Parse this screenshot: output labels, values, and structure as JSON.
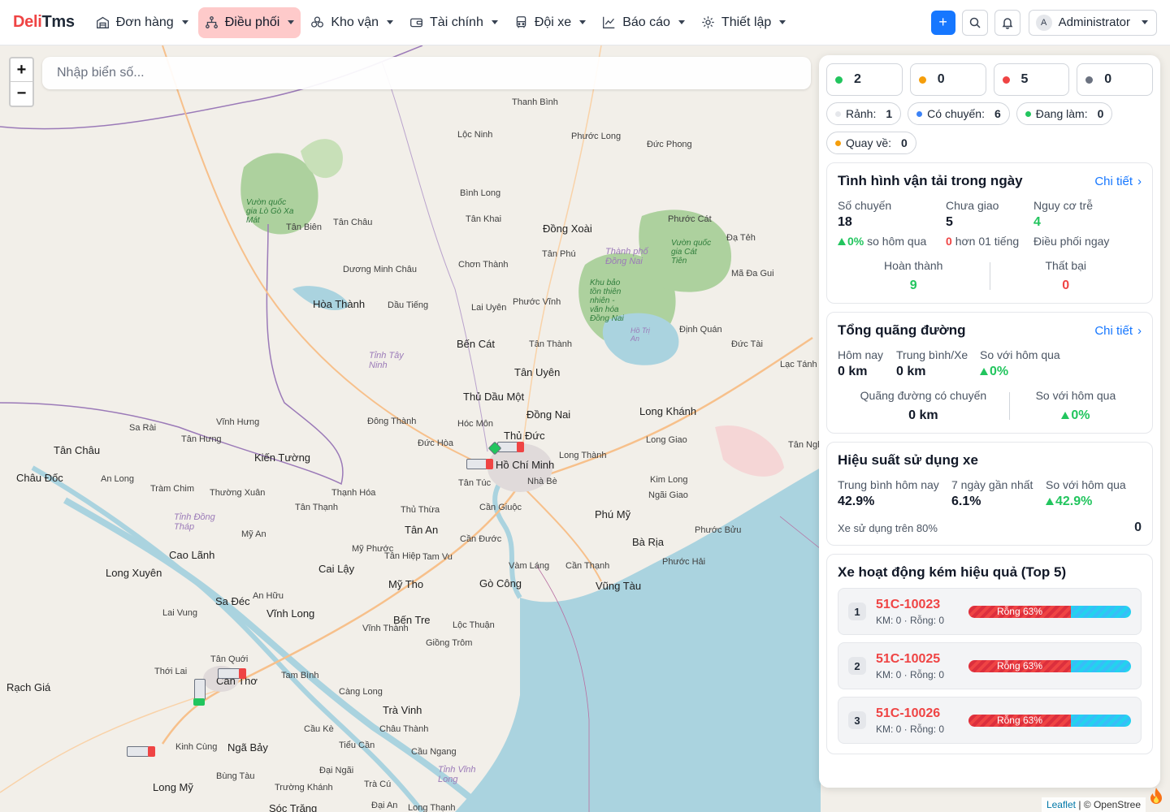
{
  "brand": {
    "part1": "Deli",
    "part2": "Tms"
  },
  "nav": [
    {
      "label": "Đơn hàng",
      "icon": "warehouse-icon"
    },
    {
      "label": "Điều phối",
      "icon": "route-icon",
      "active": true
    },
    {
      "label": "Kho vận",
      "icon": "boxes-icon"
    },
    {
      "label": "Tài chính",
      "icon": "wallet-icon"
    },
    {
      "label": "Đội xe",
      "icon": "bus-icon"
    },
    {
      "label": "Báo cáo",
      "icon": "chart-line-icon"
    },
    {
      "label": "Thiết lập",
      "icon": "gear-icon"
    }
  ],
  "header_actions": {
    "add": "+",
    "user": "Administrator",
    "avatar_initial": "A"
  },
  "map": {
    "search_placeholder": "Nhập biển số...",
    "zoom_in": "+",
    "zoom_out": "−",
    "attribution_leaflet": "Leaflet",
    "attribution_rest": "| © OpenStree",
    "labels": [
      "Thanh Bình",
      "Lộc Ninh",
      "Phước Long",
      "Đức Phong",
      "Bình Long",
      "Tân Khai",
      "Đồng Xoài",
      "Phước Cát",
      "Tân Biên",
      "Tân Châu",
      "Dương Minh Châu",
      "Chơn Thành",
      "Tân Phú",
      "Hòa Thành",
      "Dầu Tiếng",
      "Lai Uyên",
      "Phước Vĩnh",
      "Bến Cát",
      "Tân Thành",
      "Tân Uyên",
      "Thủ Dầu Một",
      "Đồng Nai",
      "Long Khánh",
      "Thủ Đức",
      "Hóc Môn",
      "Hồ Chí Minh",
      "Tân Túc",
      "Nhà Bè",
      "Long Thành",
      "Long Giao",
      "Kim Long",
      "Ngãi Giao",
      "Phú Mỹ",
      "Bà Rịa",
      "Phước Bửu",
      "Phước Hải",
      "Vũng Tàu",
      "Cần Thạnh",
      "Vàm Láng",
      "Gò Công",
      "Cần Giuộc",
      "Cần Đước",
      "Tân An",
      "Thủ Thừa",
      "Tân Thạnh",
      "Thạnh Hóa",
      "Đức Hòa",
      "Đông Thành",
      "Kiến Tường",
      "Vĩnh Hưng",
      "Tân Hưng",
      "Sa Rài",
      "Tân Châu",
      "Châu Đốc",
      "An Long",
      "Tràm Chim",
      "Thường Xuân",
      "Cao Lãnh",
      "Mỹ An",
      "Mỹ Phước",
      "Tân Hiệp",
      "Tam Vu",
      "Mỹ Tho",
      "Cai Lậy",
      "Bến Tre",
      "Giồng Trôm",
      "Lộc Thuận",
      "Vĩnh Long",
      "Sa Đéc",
      "An Hữu",
      "Long Xuyên",
      "Lai Vung",
      "Cần Thơ",
      "Tân Quới",
      "Thới Lai",
      "Rạch Giá",
      "Vĩnh Thành",
      "Trà Vinh",
      "Càng Long",
      "Tam Bình",
      "Cầu Kè",
      "Tiểu Cần",
      "Châu Thành",
      "Cầu Ngang",
      "Ngã Bảy",
      "Kinh Cùng",
      "Long Mỹ",
      "Bùng Tàu",
      "Trường Khánh",
      "Đại Ngãi",
      "Sóc Trăng",
      "Đại An",
      "Long Thạnh",
      "Trà Cú",
      "Định Quán",
      "Đức Tài",
      "Mã Đa Gui",
      "Lạc Tánh",
      "Tân Nghĩa",
      "Đạ Tẻh",
      "Tân Phú"
    ],
    "park_labels": [
      "Vườn quốc gia Lò Gò Xa Mát",
      "Thành phố Đồng Nai",
      "Vườn quốc gia Cát Tiên",
      "Khu bảo tồn thiên nhiên - văn hóa Đồng Nai",
      "Hồ Trị An"
    ],
    "province_labels": [
      "Tỉnh Tây Ninh",
      "Tỉnh Đồng Tháp",
      "Tỉnh Vĩnh Long"
    ]
  },
  "status_counts": [
    {
      "value": "2",
      "color": "#22c55e"
    },
    {
      "value": "0",
      "color": "#f59e0b"
    },
    {
      "value": "5",
      "color": "#ef4444"
    },
    {
      "value": "0",
      "color": "#6b7280"
    }
  ],
  "chips": [
    {
      "label": "Rảnh:",
      "value": "1",
      "color": "#e5e7eb"
    },
    {
      "label": "Có chuyến:",
      "value": "6",
      "color": "#3b82f6"
    },
    {
      "label": "Đang làm:",
      "value": "0",
      "color": "#22c55e"
    },
    {
      "label": "Quay về:",
      "value": "0",
      "color": "#f59e0b"
    }
  ],
  "transport": {
    "title": "Tình hình vận tải trong ngày",
    "link": "Chi tiết",
    "trips_label": "Số chuyến",
    "trips_value": "18",
    "trips_delta": "0%",
    "trips_delta_text": "so hôm qua",
    "undelivered_label": "Chưa giao",
    "undelivered_value": "5",
    "undelivered_sub_value": "0",
    "undelivered_sub_text": "hơn 01 tiếng",
    "risk_label": "Nguy cơ trễ",
    "risk_value": "4",
    "risk_action": "Điều phối ngay",
    "done_label": "Hoàn thành",
    "done_value": "9",
    "fail_label": "Thất bại",
    "fail_value": "0"
  },
  "distance": {
    "title": "Tổng quãng đường",
    "link": "Chi tiết",
    "today_label": "Hôm nay",
    "today_value": "0 km",
    "avg_label": "Trung bình/Xe",
    "avg_value": "0 km",
    "cmp_label": "So với hôm qua",
    "cmp_value": "0%",
    "trip_dist_label": "Quãng đường có chuyến",
    "trip_dist_value": "0 km",
    "cmp2_label": "So với hôm qua",
    "cmp2_value": "0%"
  },
  "efficiency": {
    "title": "Hiệu suất sử dụng xe",
    "avg_label": "Trung bình hôm nay",
    "avg_value": "42.9%",
    "week_label": "7 ngày gần nhất",
    "week_value": "6.1%",
    "cmp_label": "So với hôm qua",
    "cmp_value": "42.9%",
    "over80_label": "Xe sử dụng trên 80%",
    "over80_value": "0"
  },
  "low_perf": {
    "title": "Xe hoạt động kém hiệu quả (Top 5)",
    "vehicles": [
      {
        "rank": "1",
        "plate": "51C-10023",
        "meta": "KM: 0 · Rỗng: 0",
        "bar_label": "Rỗng 63%",
        "empty_pct": 63
      },
      {
        "rank": "2",
        "plate": "51C-10025",
        "meta": "KM: 0 · Rỗng: 0",
        "bar_label": "Rỗng 63%",
        "empty_pct": 63
      },
      {
        "rank": "3",
        "plate": "51C-10026",
        "meta": "KM: 0 · Rỗng: 0",
        "bar_label": "Rỗng 63%",
        "empty_pct": 63
      }
    ]
  }
}
